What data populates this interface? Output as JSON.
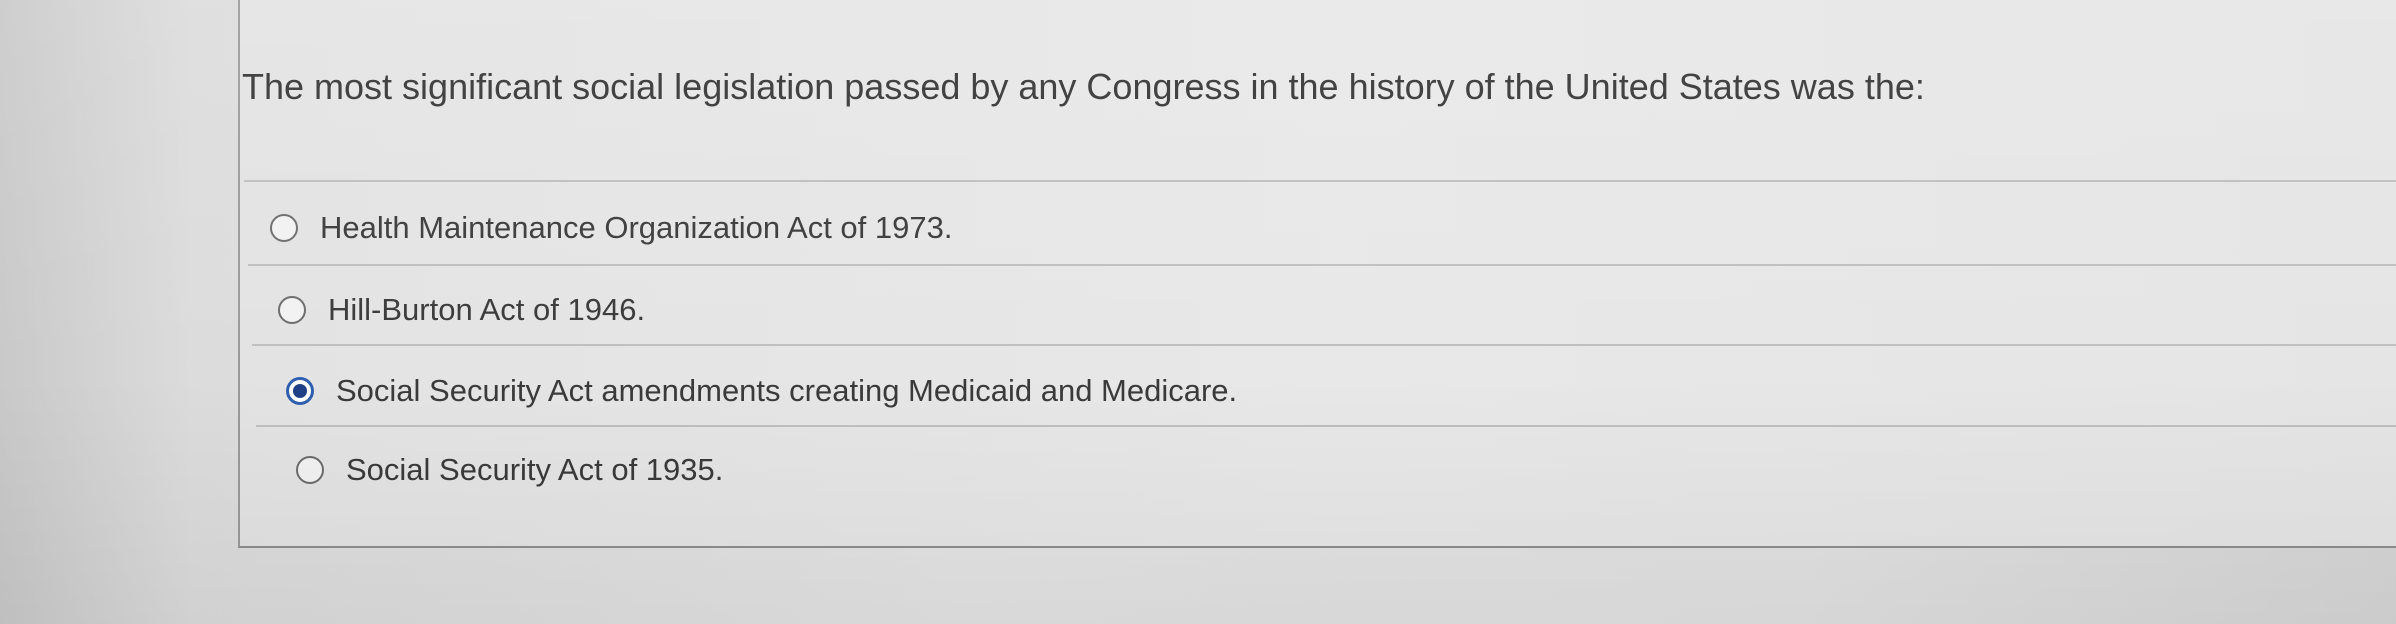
{
  "question": {
    "text": "The most significant social legislation passed by any Congress in the history of the United States was the:"
  },
  "options": [
    {
      "label": "Health Maintenance Organization Act of 1973.",
      "selected": false
    },
    {
      "label": "Hill-Burton Act of 1946.",
      "selected": false
    },
    {
      "label": "Social Security Act amendments creating Medicaid and Medicare.",
      "selected": true
    },
    {
      "label": "Social Security Act of 1935.",
      "selected": false
    }
  ],
  "colors": {
    "radio_selected": "#2f5fb0",
    "text": "#333333",
    "background": "#e4e4e4"
  }
}
